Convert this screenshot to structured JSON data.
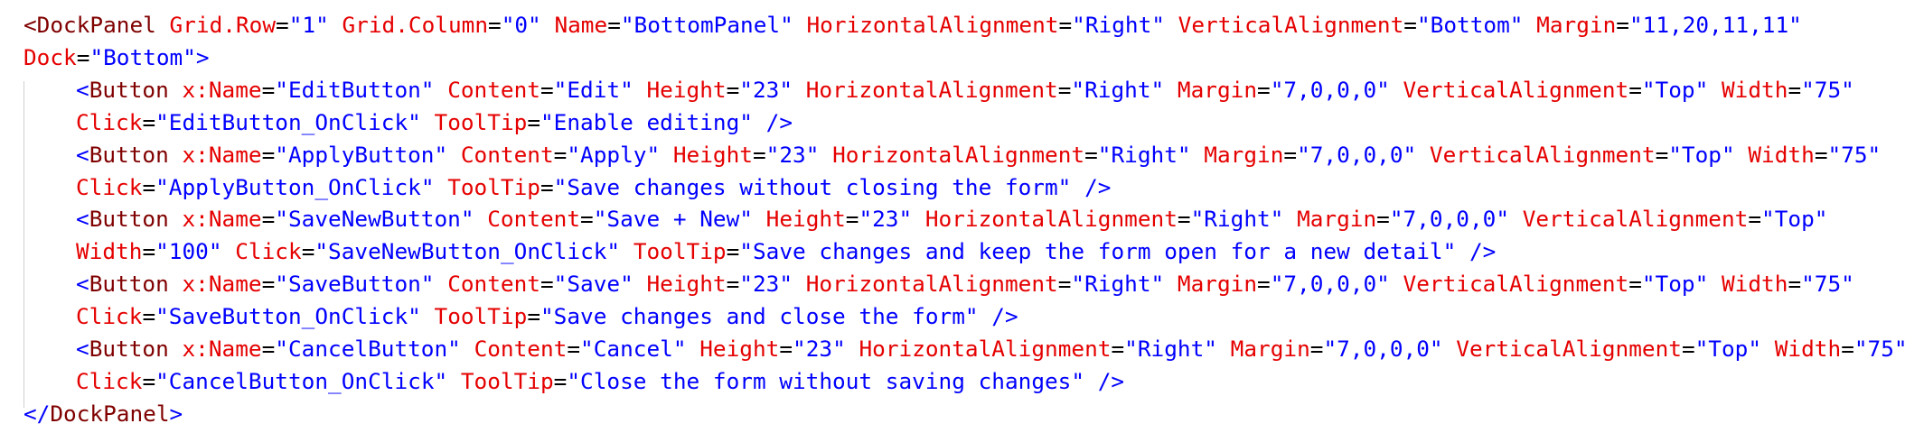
{
  "lines": [
    {
      "tokens": [
        {
          "t": "tag",
          "v": "<DockPanel"
        },
        {
          "t": "plain",
          "v": " "
        },
        {
          "t": "attr",
          "v": "Grid.Row"
        },
        {
          "t": "plain",
          "v": "="
        },
        {
          "t": "val",
          "v": "\"1\""
        },
        {
          "t": "plain",
          "v": " "
        },
        {
          "t": "attr",
          "v": "Grid.Column"
        },
        {
          "t": "plain",
          "v": "="
        },
        {
          "t": "val",
          "v": "\"0\""
        },
        {
          "t": "plain",
          "v": " "
        },
        {
          "t": "attr",
          "v": "Name"
        },
        {
          "t": "plain",
          "v": "="
        },
        {
          "t": "val",
          "v": "\"BottomPanel\""
        },
        {
          "t": "plain",
          "v": " "
        },
        {
          "t": "attr",
          "v": "HorizontalAlignment"
        },
        {
          "t": "plain",
          "v": "="
        },
        {
          "t": "val",
          "v": "\"Right\""
        },
        {
          "t": "plain",
          "v": " "
        },
        {
          "t": "attr",
          "v": "VerticalAlignment"
        },
        {
          "t": "plain",
          "v": "="
        },
        {
          "t": "val",
          "v": "\"Bottom\""
        },
        {
          "t": "plain",
          "v": " "
        },
        {
          "t": "attr",
          "v": "Margin"
        },
        {
          "t": "plain",
          "v": "="
        },
        {
          "t": "val",
          "v": "\"11,20,11,11\""
        }
      ]
    },
    {
      "tokens": [
        {
          "t": "attr",
          "v": "Dock"
        },
        {
          "t": "plain",
          "v": "="
        },
        {
          "t": "val",
          "v": "\"Bottom\""
        },
        {
          "t": "punct",
          "v": ">"
        }
      ]
    },
    {
      "indent": true,
      "tokens": [
        {
          "t": "punct",
          "v": "<"
        },
        {
          "t": "tag",
          "v": "Button"
        },
        {
          "t": "plain",
          "v": " "
        },
        {
          "t": "attr",
          "v": "x:Name"
        },
        {
          "t": "plain",
          "v": "="
        },
        {
          "t": "val",
          "v": "\"EditButton\""
        },
        {
          "t": "plain",
          "v": " "
        },
        {
          "t": "attr",
          "v": "Content"
        },
        {
          "t": "plain",
          "v": "="
        },
        {
          "t": "val",
          "v": "\"Edit\""
        },
        {
          "t": "plain",
          "v": " "
        },
        {
          "t": "attr",
          "v": "Height"
        },
        {
          "t": "plain",
          "v": "="
        },
        {
          "t": "val",
          "v": "\"23\""
        },
        {
          "t": "plain",
          "v": " "
        },
        {
          "t": "attr",
          "v": "HorizontalAlignment"
        },
        {
          "t": "plain",
          "v": "="
        },
        {
          "t": "val",
          "v": "\"Right\""
        },
        {
          "t": "plain",
          "v": " "
        },
        {
          "t": "attr",
          "v": "Margin"
        },
        {
          "t": "plain",
          "v": "="
        },
        {
          "t": "val",
          "v": "\"7,0,0,0\""
        },
        {
          "t": "plain",
          "v": " "
        },
        {
          "t": "attr",
          "v": "VerticalAlignment"
        },
        {
          "t": "plain",
          "v": "="
        },
        {
          "t": "val",
          "v": "\"Top\""
        },
        {
          "t": "plain",
          "v": " "
        },
        {
          "t": "attr",
          "v": "Width"
        },
        {
          "t": "plain",
          "v": "="
        },
        {
          "t": "val",
          "v": "\"75\""
        }
      ]
    },
    {
      "indent": true,
      "tokens": [
        {
          "t": "attr",
          "v": "Click"
        },
        {
          "t": "plain",
          "v": "="
        },
        {
          "t": "val",
          "v": "\"EditButton_OnClick\""
        },
        {
          "t": "plain",
          "v": " "
        },
        {
          "t": "attr",
          "v": "ToolTip"
        },
        {
          "t": "plain",
          "v": "="
        },
        {
          "t": "val",
          "v": "\"Enable editing\""
        },
        {
          "t": "plain",
          "v": " "
        },
        {
          "t": "punct",
          "v": "/>"
        }
      ]
    },
    {
      "indent": true,
      "tokens": [
        {
          "t": "punct",
          "v": "<"
        },
        {
          "t": "tag",
          "v": "Button"
        },
        {
          "t": "plain",
          "v": " "
        },
        {
          "t": "attr",
          "v": "x:Name"
        },
        {
          "t": "plain",
          "v": "="
        },
        {
          "t": "val",
          "v": "\"ApplyButton\""
        },
        {
          "t": "plain",
          "v": " "
        },
        {
          "t": "attr",
          "v": "Content"
        },
        {
          "t": "plain",
          "v": "="
        },
        {
          "t": "val",
          "v": "\"Apply\""
        },
        {
          "t": "plain",
          "v": " "
        },
        {
          "t": "attr",
          "v": "Height"
        },
        {
          "t": "plain",
          "v": "="
        },
        {
          "t": "val",
          "v": "\"23\""
        },
        {
          "t": "plain",
          "v": " "
        },
        {
          "t": "attr",
          "v": "HorizontalAlignment"
        },
        {
          "t": "plain",
          "v": "="
        },
        {
          "t": "val",
          "v": "\"Right\""
        },
        {
          "t": "plain",
          "v": " "
        },
        {
          "t": "attr",
          "v": "Margin"
        },
        {
          "t": "plain",
          "v": "="
        },
        {
          "t": "val",
          "v": "\"7,0,0,0\""
        },
        {
          "t": "plain",
          "v": " "
        },
        {
          "t": "attr",
          "v": "VerticalAlignment"
        },
        {
          "t": "plain",
          "v": "="
        },
        {
          "t": "val",
          "v": "\"Top\""
        },
        {
          "t": "plain",
          "v": " "
        },
        {
          "t": "attr",
          "v": "Width"
        },
        {
          "t": "plain",
          "v": "="
        },
        {
          "t": "val",
          "v": "\"75\""
        }
      ]
    },
    {
      "indent": true,
      "tokens": [
        {
          "t": "attr",
          "v": "Click"
        },
        {
          "t": "plain",
          "v": "="
        },
        {
          "t": "val",
          "v": "\"ApplyButton_OnClick\""
        },
        {
          "t": "plain",
          "v": " "
        },
        {
          "t": "attr",
          "v": "ToolTip"
        },
        {
          "t": "plain",
          "v": "="
        },
        {
          "t": "val",
          "v": "\"Save changes without closing the form\""
        },
        {
          "t": "plain",
          "v": " "
        },
        {
          "t": "punct",
          "v": "/>"
        }
      ]
    },
    {
      "indent": true,
      "tokens": [
        {
          "t": "punct",
          "v": "<"
        },
        {
          "t": "tag",
          "v": "Button"
        },
        {
          "t": "plain",
          "v": " "
        },
        {
          "t": "attr",
          "v": "x:Name"
        },
        {
          "t": "plain",
          "v": "="
        },
        {
          "t": "val",
          "v": "\"SaveNewButton\""
        },
        {
          "t": "plain",
          "v": " "
        },
        {
          "t": "attr",
          "v": "Content"
        },
        {
          "t": "plain",
          "v": "="
        },
        {
          "t": "val",
          "v": "\"Save + New\""
        },
        {
          "t": "plain",
          "v": " "
        },
        {
          "t": "attr",
          "v": "Height"
        },
        {
          "t": "plain",
          "v": "="
        },
        {
          "t": "val",
          "v": "\"23\""
        },
        {
          "t": "plain",
          "v": " "
        },
        {
          "t": "attr",
          "v": "HorizontalAlignment"
        },
        {
          "t": "plain",
          "v": "="
        },
        {
          "t": "val",
          "v": "\"Right\""
        },
        {
          "t": "plain",
          "v": " "
        },
        {
          "t": "attr",
          "v": "Margin"
        },
        {
          "t": "plain",
          "v": "="
        },
        {
          "t": "val",
          "v": "\"7,0,0,0\""
        },
        {
          "t": "plain",
          "v": " "
        },
        {
          "t": "attr",
          "v": "VerticalAlignment"
        },
        {
          "t": "plain",
          "v": "="
        },
        {
          "t": "val",
          "v": "\"Top\""
        }
      ]
    },
    {
      "indent": true,
      "tokens": [
        {
          "t": "attr",
          "v": "Width"
        },
        {
          "t": "plain",
          "v": "="
        },
        {
          "t": "val",
          "v": "\"100\""
        },
        {
          "t": "plain",
          "v": " "
        },
        {
          "t": "attr",
          "v": "Click"
        },
        {
          "t": "plain",
          "v": "="
        },
        {
          "t": "val",
          "v": "\"SaveNewButton_OnClick\""
        },
        {
          "t": "plain",
          "v": " "
        },
        {
          "t": "attr",
          "v": "ToolTip"
        },
        {
          "t": "plain",
          "v": "="
        },
        {
          "t": "val",
          "v": "\"Save changes and keep the form open for a new detail\""
        },
        {
          "t": "plain",
          "v": " "
        },
        {
          "t": "punct",
          "v": "/>"
        }
      ]
    },
    {
      "indent": true,
      "tokens": [
        {
          "t": "punct",
          "v": "<"
        },
        {
          "t": "tag",
          "v": "Button"
        },
        {
          "t": "plain",
          "v": " "
        },
        {
          "t": "attr",
          "v": "x:Name"
        },
        {
          "t": "plain",
          "v": "="
        },
        {
          "t": "val",
          "v": "\"SaveButton\""
        },
        {
          "t": "plain",
          "v": " "
        },
        {
          "t": "attr",
          "v": "Content"
        },
        {
          "t": "plain",
          "v": "="
        },
        {
          "t": "val",
          "v": "\"Save\""
        },
        {
          "t": "plain",
          "v": " "
        },
        {
          "t": "attr",
          "v": "Height"
        },
        {
          "t": "plain",
          "v": "="
        },
        {
          "t": "val",
          "v": "\"23\""
        },
        {
          "t": "plain",
          "v": " "
        },
        {
          "t": "attr",
          "v": "HorizontalAlignment"
        },
        {
          "t": "plain",
          "v": "="
        },
        {
          "t": "val",
          "v": "\"Right\""
        },
        {
          "t": "plain",
          "v": " "
        },
        {
          "t": "attr",
          "v": "Margin"
        },
        {
          "t": "plain",
          "v": "="
        },
        {
          "t": "val",
          "v": "\"7,0,0,0\""
        },
        {
          "t": "plain",
          "v": " "
        },
        {
          "t": "attr",
          "v": "VerticalAlignment"
        },
        {
          "t": "plain",
          "v": "="
        },
        {
          "t": "val",
          "v": "\"Top\""
        },
        {
          "t": "plain",
          "v": " "
        },
        {
          "t": "attr",
          "v": "Width"
        },
        {
          "t": "plain",
          "v": "="
        },
        {
          "t": "val",
          "v": "\"75\""
        }
      ]
    },
    {
      "indent": true,
      "tokens": [
        {
          "t": "attr",
          "v": "Click"
        },
        {
          "t": "plain",
          "v": "="
        },
        {
          "t": "val",
          "v": "\"SaveButton_OnClick\""
        },
        {
          "t": "plain",
          "v": " "
        },
        {
          "t": "attr",
          "v": "ToolTip"
        },
        {
          "t": "plain",
          "v": "="
        },
        {
          "t": "val",
          "v": "\"Save changes and close the form\""
        },
        {
          "t": "plain",
          "v": " "
        },
        {
          "t": "punct",
          "v": "/>"
        }
      ]
    },
    {
      "indent": true,
      "tokens": [
        {
          "t": "punct",
          "v": "<"
        },
        {
          "t": "tag",
          "v": "Button"
        },
        {
          "t": "plain",
          "v": " "
        },
        {
          "t": "attr",
          "v": "x:Name"
        },
        {
          "t": "plain",
          "v": "="
        },
        {
          "t": "val",
          "v": "\"CancelButton\""
        },
        {
          "t": "plain",
          "v": " "
        },
        {
          "t": "attr",
          "v": "Content"
        },
        {
          "t": "plain",
          "v": "="
        },
        {
          "t": "val",
          "v": "\"Cancel\""
        },
        {
          "t": "plain",
          "v": " "
        },
        {
          "t": "attr",
          "v": "Height"
        },
        {
          "t": "plain",
          "v": "="
        },
        {
          "t": "val",
          "v": "\"23\""
        },
        {
          "t": "plain",
          "v": " "
        },
        {
          "t": "attr",
          "v": "HorizontalAlignment"
        },
        {
          "t": "plain",
          "v": "="
        },
        {
          "t": "val",
          "v": "\"Right\""
        },
        {
          "t": "plain",
          "v": " "
        },
        {
          "t": "attr",
          "v": "Margin"
        },
        {
          "t": "plain",
          "v": "="
        },
        {
          "t": "val",
          "v": "\"7,0,0,0\""
        },
        {
          "t": "plain",
          "v": " "
        },
        {
          "t": "attr",
          "v": "VerticalAlignment"
        },
        {
          "t": "plain",
          "v": "="
        },
        {
          "t": "val",
          "v": "\"Top\""
        },
        {
          "t": "plain",
          "v": " "
        },
        {
          "t": "attr",
          "v": "Width"
        },
        {
          "t": "plain",
          "v": "="
        },
        {
          "t": "val",
          "v": "\"75\""
        }
      ]
    },
    {
      "indent": true,
      "tokens": [
        {
          "t": "attr",
          "v": "Click"
        },
        {
          "t": "plain",
          "v": "="
        },
        {
          "t": "val",
          "v": "\"CancelButton_OnClick\""
        },
        {
          "t": "plain",
          "v": " "
        },
        {
          "t": "attr",
          "v": "ToolTip"
        },
        {
          "t": "plain",
          "v": "="
        },
        {
          "t": "val",
          "v": "\"Close the form without saving changes\""
        },
        {
          "t": "plain",
          "v": " "
        },
        {
          "t": "punct",
          "v": "/>"
        }
      ]
    },
    {
      "tokens": [
        {
          "t": "punct",
          "v": "</"
        },
        {
          "t": "tag",
          "v": "DockPanel"
        },
        {
          "t": "punct",
          "v": ">"
        }
      ]
    }
  ]
}
